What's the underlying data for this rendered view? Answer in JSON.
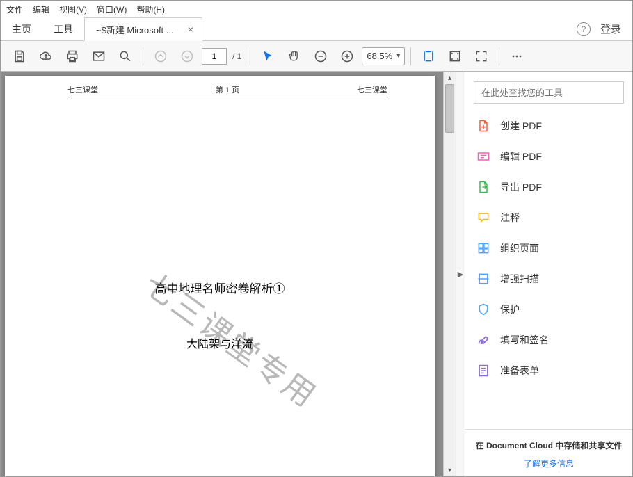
{
  "menu": {
    "file": "文件",
    "edit": "编辑",
    "view": "视图(V)",
    "window": "窗口(W)",
    "help": "帮助(H)"
  },
  "tabs": {
    "home": "主页",
    "tools": "工具",
    "doc": "~$新建 Microsoft ...",
    "login": "登录"
  },
  "toolbar": {
    "page_current": "1",
    "page_total": "/ 1",
    "zoom": "68.5%"
  },
  "page": {
    "header_left": "七三课堂",
    "header_center": "第 1 页",
    "header_right": "七三课堂",
    "title": "高中地理名师密卷解析①",
    "subtitle": "大陆架与洋流",
    "watermark": "七三课堂专用"
  },
  "sidebar": {
    "search_placeholder": "在此处查找您的工具",
    "tools": [
      {
        "id": "create",
        "label": "创建 PDF",
        "color": "#ff5c35"
      },
      {
        "id": "edit",
        "label": "编辑 PDF",
        "color": "#ff5cb8"
      },
      {
        "id": "export",
        "label": "导出 PDF",
        "color": "#3fb950"
      },
      {
        "id": "comment",
        "label": "注释",
        "color": "#ffb400"
      },
      {
        "id": "organize",
        "label": "组织页面",
        "color": "#4aa3ff"
      },
      {
        "id": "scan",
        "label": "增强扫描",
        "color": "#4aa3ff"
      },
      {
        "id": "protect",
        "label": "保护",
        "color": "#4aa3ff"
      },
      {
        "id": "fillsign",
        "label": "填写和签名",
        "color": "#8b6bd9"
      },
      {
        "id": "prepform",
        "label": "准备表单",
        "color": "#8b6bd9"
      }
    ],
    "cloud_title": "在 Document Cloud 中存储和共享文件",
    "cloud_link": "了解更多信息"
  }
}
